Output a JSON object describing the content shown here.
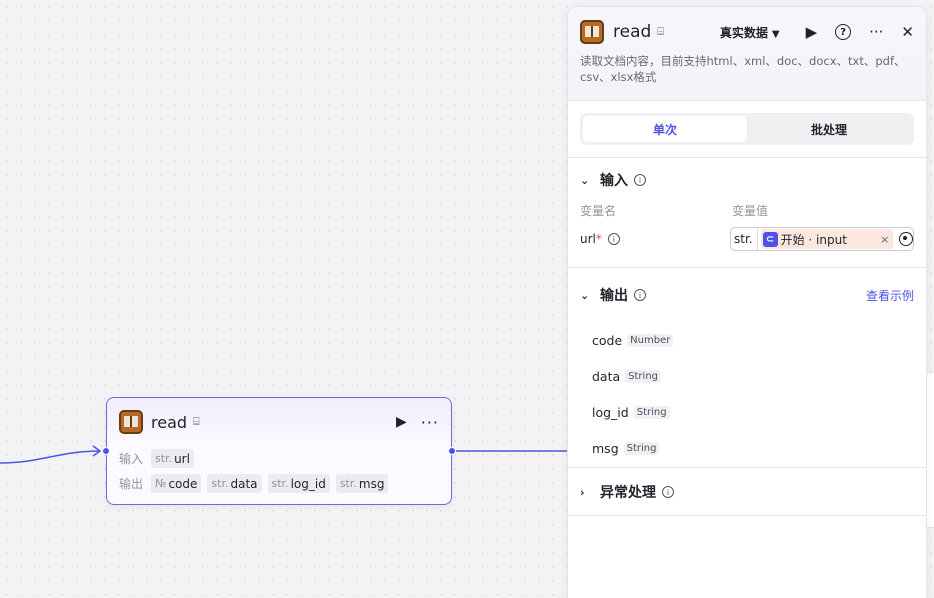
{
  "node": {
    "title": "read",
    "input_label": "输入",
    "output_label": "输出",
    "inputs": [
      {
        "type": "str.",
        "name": "url"
      }
    ],
    "outputs": [
      {
        "type": "№",
        "name": "code"
      },
      {
        "type": "str.",
        "name": "data"
      },
      {
        "type": "str.",
        "name": "log_id"
      },
      {
        "type": "str.",
        "name": "msg"
      }
    ]
  },
  "panel": {
    "title": "read",
    "mode": "真实数据",
    "description": "读取文档内容，目前支持html、xml、doc、docx、txt、pdf、csv、xlsx格式",
    "tabs": [
      {
        "label": "单次",
        "active": true
      },
      {
        "label": "批处理",
        "active": false
      }
    ],
    "input_section": {
      "title": "输入",
      "col_name": "变量名",
      "col_value": "变量值",
      "var_name": "url",
      "required_mark": "*",
      "value_type": "str.",
      "ref_text": "开始 · input",
      "clear": "×"
    },
    "output_section": {
      "title": "输出",
      "example_link": "查看示例",
      "items": [
        {
          "name": "code",
          "type": "Number"
        },
        {
          "name": "data",
          "type": "String"
        },
        {
          "name": "log_id",
          "type": "String"
        },
        {
          "name": "msg",
          "type": "String"
        }
      ]
    },
    "error_section": {
      "title": "异常处理"
    }
  },
  "icons": {
    "accent": "#4d53e8",
    "edge_color": "#4d53e8"
  }
}
